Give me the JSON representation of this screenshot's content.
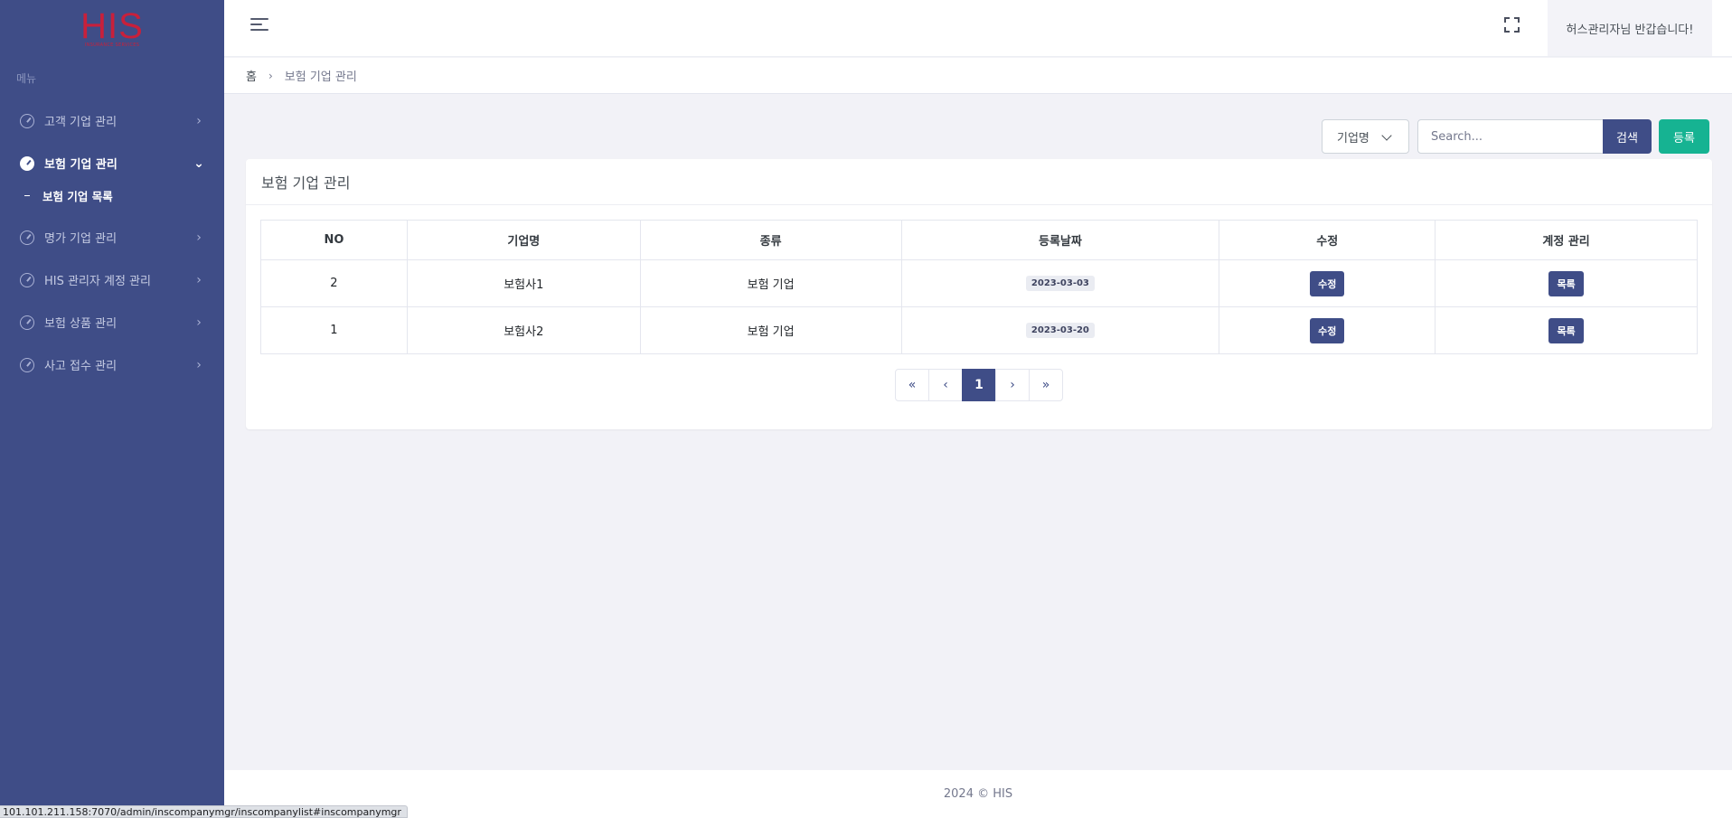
{
  "logo": {
    "main": "HIS",
    "sub": "INSURANCE SERVICES"
  },
  "sidebar": {
    "menu_title": "메뉴",
    "items": [
      {
        "label": "고객 기업 관리",
        "arrow": "›"
      },
      {
        "label": "보험 기업 관리",
        "arrow": "⌄"
      },
      {
        "label": "명가 기업 관리",
        "arrow": "›"
      },
      {
        "label": "HIS 관리자 계정 관리",
        "arrow": "›"
      },
      {
        "label": "보험 상품 관리",
        "arrow": "›"
      },
      {
        "label": "사고 접수 관리",
        "arrow": "›"
      }
    ],
    "submenu": {
      "label": "보험 기업 목록"
    }
  },
  "header": {
    "greeting": "허스관리자님 반갑습니다!"
  },
  "breadcrumb": {
    "home": "홈",
    "separator": "›",
    "current": "보험 기업 관리"
  },
  "toolbar": {
    "select_value": "기업명",
    "search_placeholder": "Search...",
    "search_label": "검색",
    "register_label": "등록"
  },
  "card": {
    "title": "보험 기업 관리"
  },
  "table": {
    "headers": [
      "NO",
      "기업명",
      "종류",
      "등록날짜",
      "수정",
      "계정 관리"
    ],
    "rows": [
      {
        "no": "2",
        "name": "보험사1",
        "type": "보험 기업",
        "date": "2023-03-03",
        "edit": "수정",
        "account": "목록"
      },
      {
        "no": "1",
        "name": "보험사2",
        "type": "보험 기업",
        "date": "2023-03-20",
        "edit": "수정",
        "account": "목록"
      }
    ]
  },
  "pagination": {
    "first": "«",
    "prev": "‹",
    "current": "1",
    "next": "›",
    "last": "»"
  },
  "footer": {
    "text": "2024 © HIS"
  },
  "statusbar": {
    "url": "101.101.211.158:7070/admin/inscompanymgr/inscompanylist#inscompanymgr"
  },
  "colors": {
    "sidebar": "#3f4d87",
    "primary": "#3f4d87",
    "success": "#16b392",
    "logo": "#c8203b"
  }
}
